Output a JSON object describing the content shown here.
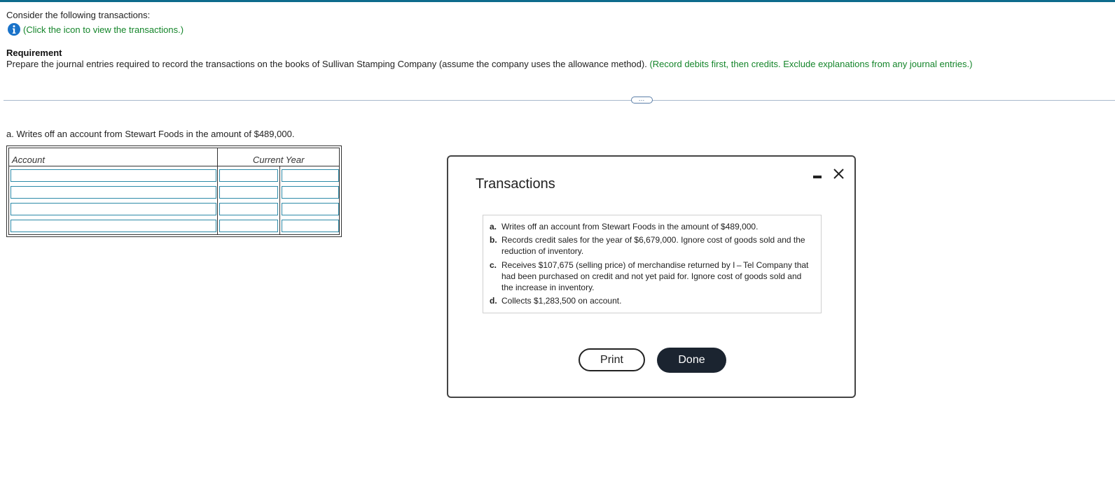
{
  "intro": {
    "text": "Consider the following transactions:",
    "info_icon": "info-icon",
    "info_link": "(Click the icon to view the transactions.)"
  },
  "requirement": {
    "title": "Requirement",
    "text": "Prepare the journal entries required to record the transactions on the books of Sullivan Stamping Company (assume the company uses the allowance method).",
    "instructions": "(Record debits first, then credits. Exclude explanations from any journal entries.)"
  },
  "more_button": "…",
  "part_a": {
    "label": "a.",
    "text": "Writes off an account from Stewart Foods in the amount of $489,000."
  },
  "journal": {
    "headers": {
      "account": "Account",
      "current_year": "Current Year"
    },
    "rows": [
      {
        "account": "",
        "debit": "",
        "credit": ""
      },
      {
        "account": "",
        "debit": "",
        "credit": ""
      },
      {
        "account": "",
        "debit": "",
        "credit": ""
      },
      {
        "account": "",
        "debit": "",
        "credit": ""
      }
    ]
  },
  "modal": {
    "title": "Transactions",
    "minimize_icon": "minimize-icon",
    "close_icon": "close-icon",
    "transactions": [
      {
        "letter": "a.",
        "text": "Writes off an account from Stewart Foods in the amount of $489,000."
      },
      {
        "letter": "b.",
        "text": "Records credit sales for the year of $6,679,000. Ignore cost of goods sold and the reduction of inventory."
      },
      {
        "letter": "c.",
        "text": "Receives $107,675 (selling price) of merchandise returned by I – Tel Company that had been purchased on credit and not yet paid for. Ignore cost of goods sold and the increase in inventory."
      },
      {
        "letter": "d.",
        "text": "Collects $1,283,500 on account."
      }
    ],
    "print_label": "Print",
    "done_label": "Done"
  },
  "colors": {
    "top_bar": "#0d6b8c",
    "link_green": "#14852a",
    "info_blue": "#1a73c9",
    "input_border": "#2d8aa8",
    "done_bg": "#1b2430"
  }
}
